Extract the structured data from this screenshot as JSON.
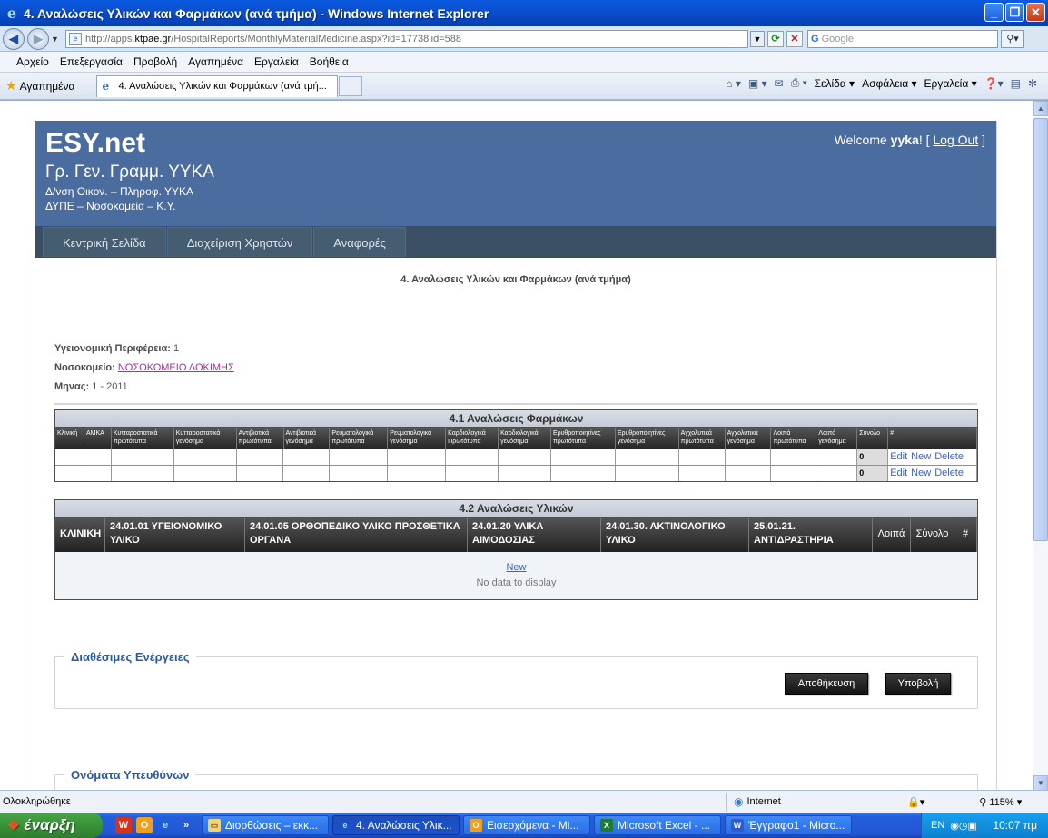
{
  "window": {
    "title": "4. Αναλώσεις Υλικών και Φαρμάκων (ανά τμήμα) - Windows Internet Explorer",
    "buttons": [
      "_",
      "❐",
      "✕"
    ]
  },
  "address": {
    "url_prefix": "http://apps.",
    "url_domain": "ktpae.gr",
    "url_suffix": "/HospitalReports/MonthlyMaterialMedicine.aspx?id=17738lid=588",
    "search_placeholder": "Google"
  },
  "menu": [
    "Αρχείο",
    "Επεξεργασία",
    "Προβολή",
    "Αγαπημένα",
    "Εργαλεία",
    "Βοήθεια"
  ],
  "favorites": {
    "label": "Αγαπημένα",
    "tab_title": "4. Αναλώσεις Υλικών και Φαρμάκων (ανά τμή..."
  },
  "commandbar": [
    "Σελίδα ▾",
    "Ασφάλεια ▾",
    "Εργαλεία ▾"
  ],
  "header": {
    "brand": "ESY.net",
    "org1": "Γρ. Γεν. Γραμμ. ΥΥΚΑ",
    "org2": "Δ/νση Οικον. – Πληροφ. ΥΥΚΑ",
    "org3": "ΔΥΠΕ – Νοσοκομεία – Κ.Υ.",
    "welcome": "Welcome ",
    "user": "yyka",
    "exclaim": "! [ ",
    "logout": "Log Out",
    "close_bracket": " ]"
  },
  "nav": [
    "Κεντρική Σελίδα",
    "Διαχείριση Χρηστών",
    "Αναφορές"
  ],
  "report_title": "4. Αναλώσεις Υλικών και Φαρμάκων (ανά τμήμα)",
  "info": {
    "region_label": "Υγειονομική Περιφέρεια:",
    "region_value": " 1",
    "hospital_label": "Νοσοκομείο:",
    "hospital_value": "ΝΟΣΟΚΟΜΕΙΟ ΔΟΚΙΜΗΣ",
    "month_label": "Μηνας:",
    "month_value": " 1 - 2011"
  },
  "grid1": {
    "caption": "4.1 Αναλώσεις Φαρμάκων",
    "columns": [
      "Κλινική",
      "ΑΜΚΑ",
      "Κυτταροστατικά πρωτότυπα",
      "Κυτταροστατικά γενόσημα",
      "Αντιβιοτικά πρωτότυπα",
      "Αντιβιοτικά γενόσημα",
      "Ρευματολογικά πρωτότυπα",
      "Ρευματολογικά γενόσημα",
      "Καρδιολογικά Πρωτότυπα",
      "Καρδιολογικά γενόσημα",
      "Ερυθροποιητίνες πρωτότυπα",
      "Ερυθροποιητίνες γενόσημα",
      "Αγχολυτικά πρωτότυπα",
      "Αγχολυτικά γενόσημα",
      "Λοιπά πρωτότυπα",
      "Λοιπά γενόσημα",
      "Σύνολο",
      "#"
    ],
    "rows": [
      {
        "total": "0",
        "edit": "Edit",
        "new": "New",
        "delete": "Delete"
      },
      {
        "total": "0",
        "edit": "Edit",
        "new": "New",
        "delete": "Delete"
      }
    ]
  },
  "grid2": {
    "caption": "4.2 Αναλώσεις Υλικών",
    "columns": [
      "ΚΛΙΝΙΚΗ",
      "24.01.01 ΥΓΕΙΟΝΟΜΙΚΟ ΥΛΙΚΟ",
      "24.01.05 ΟΡΘΟΠΕΔΙΚΟ ΥΛΙΚΟ ΠΡΟΣΘΕΤΙΚΑ ΟΡΓΑΝΑ",
      "24.01.20 ΥΛΙΚΑ ΑΙΜΟΔΟΣΙΑΣ",
      "24.01.30. ΑΚΤΙΝΟΛΟΓΙΚΟ ΥΛΙΚΟ",
      "25.01.21. ΑΝΤΙΔΡΑΣΤΗΡΙΑ",
      "Λοιπά",
      "Σύνολο",
      "#"
    ],
    "new_link": "New",
    "empty_text": "No data to display"
  },
  "actions": {
    "legend": "Διαθέσιμες Ενέργειες",
    "save": "Αποθήκευση",
    "submit": "Υποβολή"
  },
  "responsible": {
    "legend": "Ονόματα Υπευθύνων"
  },
  "status": {
    "text": "Ολοκληρώθηκε",
    "zone": "Internet",
    "zoom": "115%"
  },
  "taskbar": {
    "start": "έναρξη",
    "tasks": [
      {
        "label": "Διορθώσεις – εκκ...",
        "icon": "📁"
      },
      {
        "label": "4. Αναλώσεις Υλικ...",
        "icon": "e"
      },
      {
        "label": "Εισερχόμενα - Mi...",
        "icon": "O"
      },
      {
        "label": "Microsoft Excel - ...",
        "icon": "X"
      },
      {
        "label": "Έγγραφο1 - Micro...",
        "icon": "W"
      }
    ],
    "lang": "EN",
    "clock": "10:07 πμ"
  },
  "colors": {
    "header_bg": "#4b6c9e",
    "nav_bg": "#3a4f63",
    "legend_color": "#2c5aa0"
  }
}
